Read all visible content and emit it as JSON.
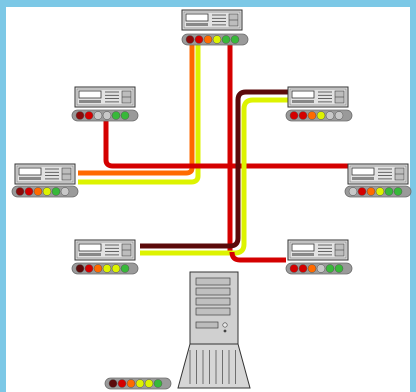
{
  "palette": {
    "frame": "#7cc8e6",
    "background": "#ffffff",
    "device_body": "#c8c8c8",
    "device_screen": "#ffffff",
    "status_strip": "#9a9a9a"
  },
  "link_colors": {
    "dark_maroon": "#5b0a0a",
    "dark_red": "#8b0b0b",
    "red": "#d40000",
    "orange": "#ff6a00",
    "yellow_green": "#ddf300",
    "green": "#38b83a",
    "gray": "#c8c8c8"
  },
  "devices": [
    {
      "id": "server-top",
      "leds": [
        "dark_red",
        "red",
        "orange",
        "yellow_green",
        "green",
        "green"
      ]
    },
    {
      "id": "server-upper-left",
      "leds": [
        "dark_red",
        "red",
        "gray",
        "gray",
        "green",
        "green"
      ]
    },
    {
      "id": "server-upper-right",
      "leds": [
        "red",
        "red",
        "orange",
        "yellow_green",
        "gray",
        "gray"
      ]
    },
    {
      "id": "server-mid-left",
      "leds": [
        "dark_red",
        "red",
        "orange",
        "yellow_green",
        "green",
        "gray"
      ]
    },
    {
      "id": "server-mid-right",
      "leds": [
        "gray",
        "red",
        "orange",
        "yellow_green",
        "green",
        "green"
      ]
    },
    {
      "id": "server-lower-left",
      "leds": [
        "dark_maroon",
        "red",
        "orange",
        "yellow_green",
        "yellow_green",
        "green"
      ]
    },
    {
      "id": "server-lower-right",
      "leds": [
        "red",
        "red",
        "orange",
        "gray",
        "green",
        "green"
      ]
    },
    {
      "id": "tower-server",
      "leds": [
        "dark_maroon",
        "red",
        "orange",
        "yellow_green",
        "yellow_green",
        "green"
      ]
    }
  ],
  "links": [
    {
      "id": "orange-link-top-to-mid-left",
      "color": "orange"
    },
    {
      "id": "yellow-link-top-to-mid-left",
      "color": "yellow_green"
    },
    {
      "id": "red-link-top-to-tower",
      "color": "red"
    },
    {
      "id": "red-link-upper-left-to-mid-right",
      "color": "red"
    },
    {
      "id": "maroon-link-upper-right-to-lower-left",
      "color": "dark_maroon"
    },
    {
      "id": "yellow-link-upper-right-to-lower-left",
      "color": "yellow_green"
    },
    {
      "id": "red-link-to-lower-right",
      "color": "red"
    }
  ]
}
